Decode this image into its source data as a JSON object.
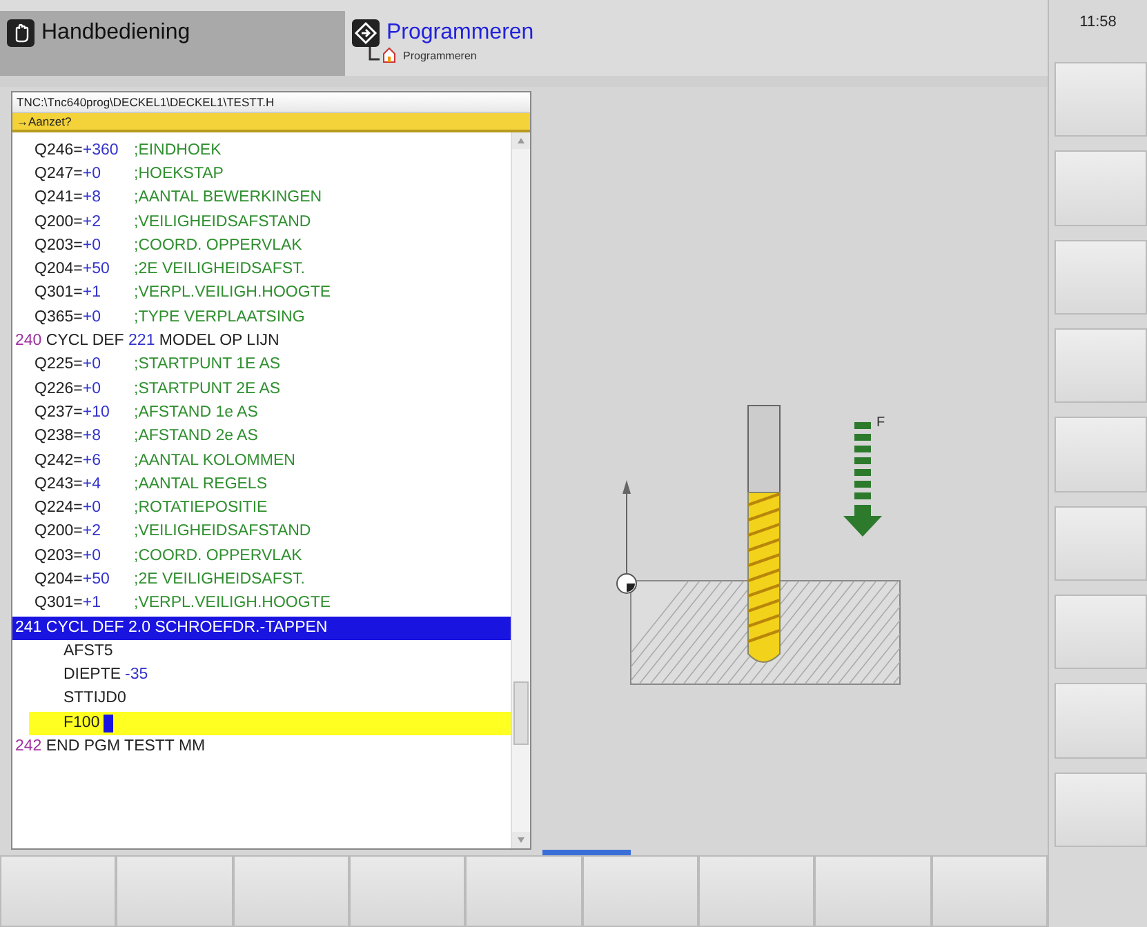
{
  "modes": [
    {
      "label": "Handbediening",
      "selected": false
    },
    {
      "label": "Programmeren",
      "selected": true,
      "sub_label": "Programmeren"
    }
  ],
  "clock": "11:58",
  "editor": {
    "path": "TNC:\\Tnc640prog\\DECKEL1\\DECKEL1\\TESTT.H",
    "prompt": "→Aanzet?",
    "lines": [
      {
        "kind": "param",
        "name": "Q246=",
        "value": "+360",
        "comment": ";EINDHOEK",
        "selected": false,
        "editing": false
      },
      {
        "kind": "param",
        "name": "Q247=",
        "value": "+0",
        "comment": ";HOEKSTAP",
        "selected": false,
        "editing": false
      },
      {
        "kind": "param",
        "name": "Q241=",
        "value": "+8",
        "comment": ";AANTAL BEWERKINGEN",
        "selected": false,
        "editing": false
      },
      {
        "kind": "param",
        "name": "Q200=",
        "value": "+2",
        "comment": ";VEILIGHEIDSAFSTAND",
        "selected": false,
        "editing": false
      },
      {
        "kind": "param",
        "name": "Q203=",
        "value": "+0",
        "comment": ";COORD. OPPERVLAK",
        "selected": false,
        "editing": false
      },
      {
        "kind": "param",
        "name": "Q204=",
        "value": "+50",
        "comment": ";2E VEILIGHEIDSAFST.",
        "selected": false,
        "editing": false
      },
      {
        "kind": "param",
        "name": "Q301=",
        "value": "+1",
        "comment": ";VERPL.VEILIGH.HOOGTE",
        "selected": false,
        "editing": false
      },
      {
        "kind": "param",
        "name": "Q365=",
        "value": "+0",
        "comment": ";TYPE VERPLAATSING",
        "selected": false,
        "editing": false
      },
      {
        "kind": "block",
        "number": "240",
        "name": "CYCL DEF",
        "value": "221",
        "comment": "MODEL OP LIJN",
        "selected": false,
        "editing": false
      },
      {
        "kind": "param",
        "name": "Q225=",
        "value": "+0",
        "comment": ";STARTPUNT 1E AS",
        "selected": false,
        "editing": false
      },
      {
        "kind": "param",
        "name": "Q226=",
        "value": "+0",
        "comment": ";STARTPUNT 2E AS",
        "selected": false,
        "editing": false
      },
      {
        "kind": "param",
        "name": "Q237=",
        "value": "+10",
        "comment": ";AFSTAND 1e AS",
        "selected": false,
        "editing": false
      },
      {
        "kind": "param",
        "name": "Q238=",
        "value": "+8",
        "comment": ";AFSTAND 2e AS",
        "selected": false,
        "editing": false
      },
      {
        "kind": "param",
        "name": "Q242=",
        "value": "+6",
        "comment": ";AANTAL KOLOMMEN",
        "selected": false,
        "editing": false
      },
      {
        "kind": "param",
        "name": "Q243=",
        "value": "+4",
        "comment": ";AANTAL REGELS",
        "selected": false,
        "editing": false
      },
      {
        "kind": "param",
        "name": "Q224=",
        "value": "+0",
        "comment": ";ROTATIEPOSITIE",
        "selected": false,
        "editing": false
      },
      {
        "kind": "param",
        "name": "Q200=",
        "value": "+2",
        "comment": ";VEILIGHEIDSAFSTAND",
        "selected": false,
        "editing": false
      },
      {
        "kind": "param",
        "name": "Q203=",
        "value": "+0",
        "comment": ";COORD. OPPERVLAK",
        "selected": false,
        "editing": false
      },
      {
        "kind": "param",
        "name": "Q204=",
        "value": "+50",
        "comment": ";2E VEILIGHEIDSAFST.",
        "selected": false,
        "editing": false
      },
      {
        "kind": "param",
        "name": "Q301=",
        "value": "+1",
        "comment": ";VERPL.VEILIGH.HOOGTE",
        "selected": false,
        "editing": false
      },
      {
        "kind": "block",
        "number": "241",
        "name": "CYCL DEF 2.0 SCHROEFDR.-TAPPEN",
        "selected": true,
        "editing": false
      },
      {
        "kind": "sub",
        "name": "AFST5",
        "selected": false,
        "editing": false
      },
      {
        "kind": "sub",
        "name": "DIEPTE",
        "value": "-35",
        "selected": false,
        "editing": false
      },
      {
        "kind": "sub",
        "name": "STTIJD0",
        "selected": false,
        "editing": false
      },
      {
        "kind": "sub",
        "name": "F100",
        "selected": false,
        "editing": true
      },
      {
        "kind": "block",
        "number": "242",
        "name": "END PGM TESTT MM",
        "selected": false,
        "editing": false
      }
    ]
  },
  "graphic": {
    "feed_label": "F"
  }
}
